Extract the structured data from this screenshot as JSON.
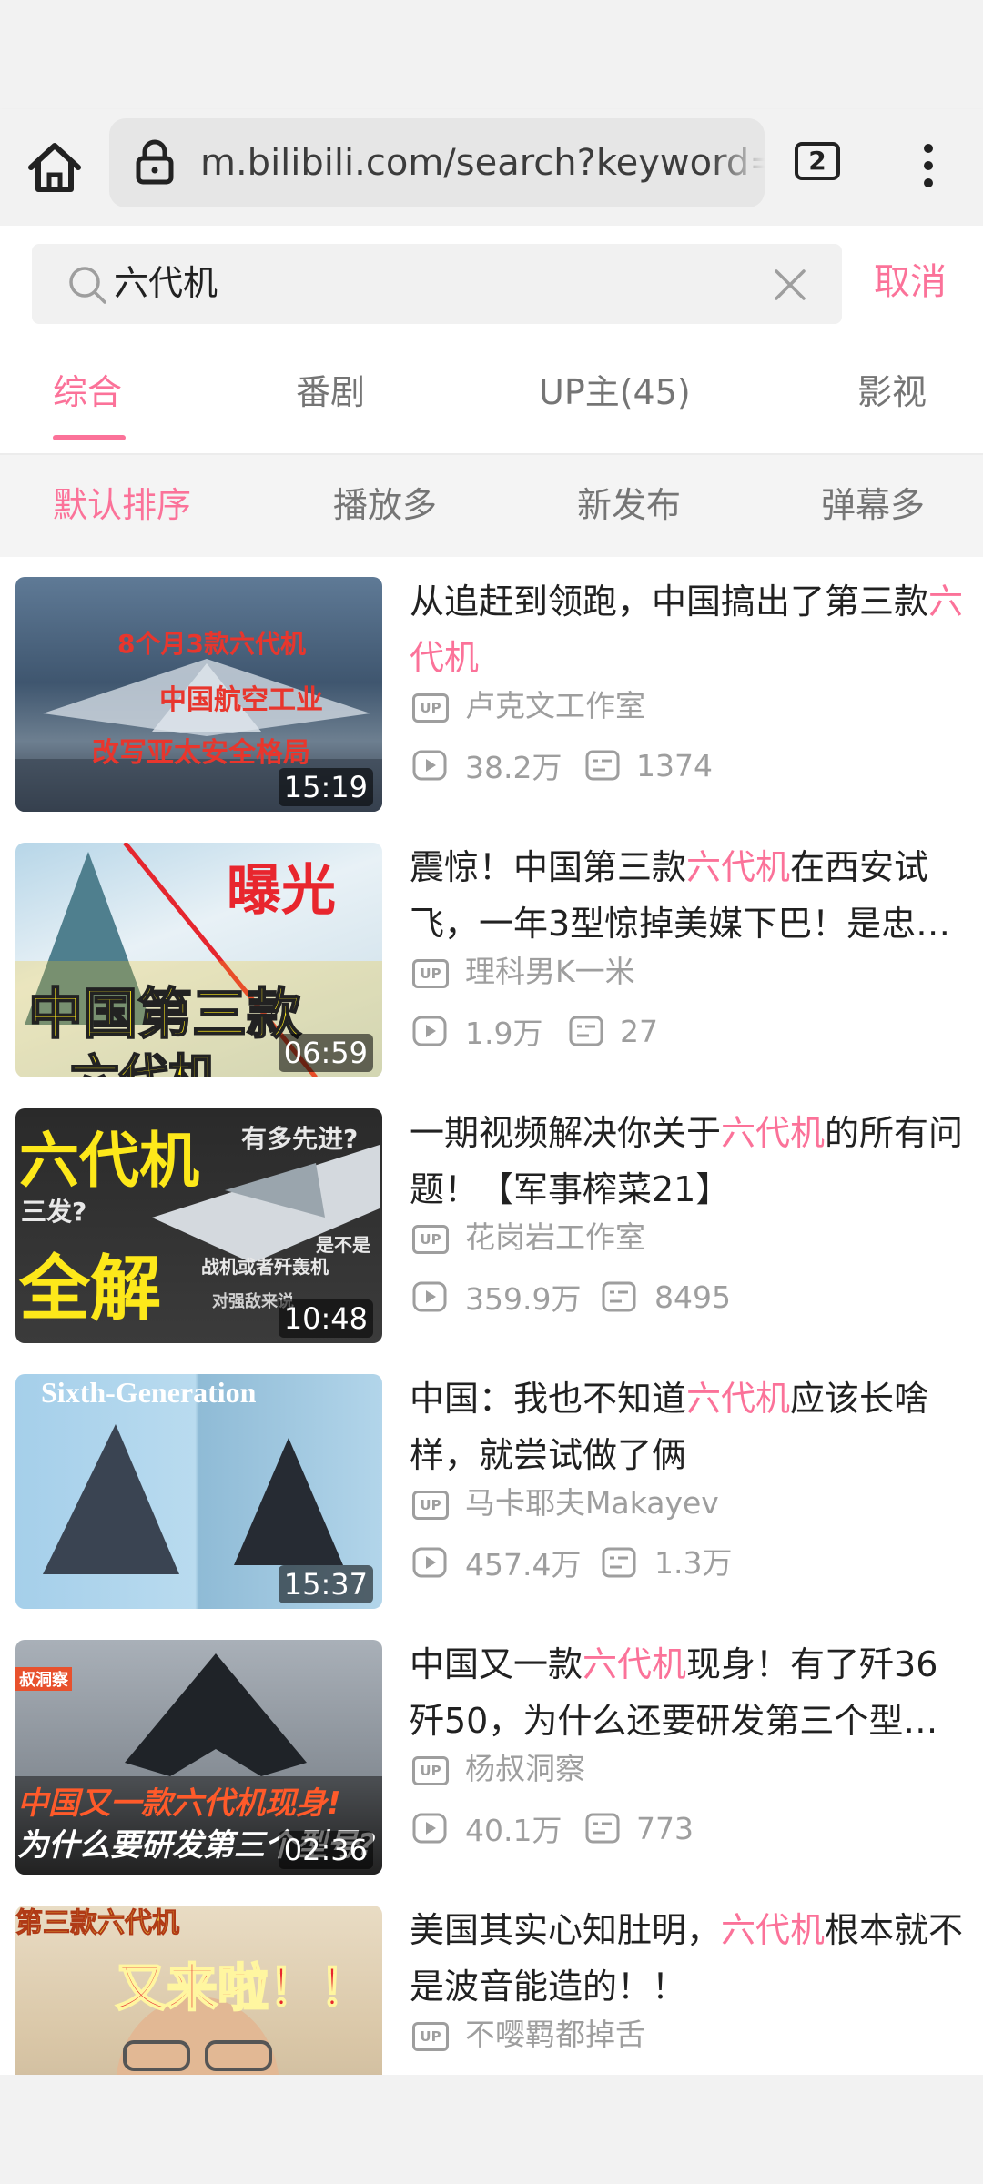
{
  "browser": {
    "url": "m.bilibili.com/search?keyword=",
    "tab_count": "2"
  },
  "search": {
    "value": "六代机",
    "cancel_label": "取消"
  },
  "tabs": [
    {
      "label": "综合",
      "active": true
    },
    {
      "label": "番剧"
    },
    {
      "label": "UP主(45)"
    },
    {
      "label": "影视"
    }
  ],
  "sort_options": [
    {
      "label": "默认排序",
      "active": true
    },
    {
      "label": "播放多"
    },
    {
      "label": "新发布"
    },
    {
      "label": "弹幕多"
    }
  ],
  "videos": [
    {
      "title_before": "从追赶到领跑，中国搞出了第三款",
      "title_highlight": "六代机",
      "title_after": "",
      "uploader": "卢克文工作室",
      "plays": "38.2万",
      "danmaku": "1374",
      "duration": "15:19",
      "thumb_text": [
        "8个月3款六代机",
        "中国航空工业",
        "改写亚太安全格局"
      ]
    },
    {
      "title_before": "震惊！中国第三款",
      "title_highlight": "六代机",
      "title_after": "在西安试飞，一年3型惊掉美媒下巴！是忠…",
      "uploader": "理科男K一米",
      "plays": "1.9万",
      "danmaku": "27",
      "duration": "06:59",
      "thumb_text": [
        "曝光",
        "中国第三款",
        "六代机"
      ]
    },
    {
      "title_before": "一期视频解决你关于",
      "title_highlight": "六代机",
      "title_after": "的所有问题！【军事榨菜21】",
      "uploader": "花岗岩工作室",
      "plays": "359.9万",
      "danmaku": "8495",
      "duration": "10:48",
      "thumb_text": [
        "六代机",
        "有多先进?",
        "三发?",
        "全解",
        "是不是",
        "战机或者歼轰机",
        "对强敌来说"
      ]
    },
    {
      "title_before": "中国：我也不知道",
      "title_highlight": "六代机",
      "title_after": "应该长啥样，就尝试做了俩",
      "uploader": "马卡耶夫Makayev",
      "plays": "457.4万",
      "danmaku": "1.3万",
      "duration": "15:37",
      "thumb_text": [
        "Sixth-Generation"
      ]
    },
    {
      "title_before": "中国又一款",
      "title_highlight": "六代机",
      "title_after": "现身！有了歼36歼50，为什么还要研发第三个型…",
      "uploader": "杨叔洞察",
      "plays": "40.1万",
      "danmaku": "773",
      "duration": "02:36",
      "thumb_text": [
        "叔洞察",
        "中国又一款六代机现身!",
        "为什么要研发第三个型号?"
      ]
    },
    {
      "title_before": "美国其实心知肚明，",
      "title_highlight": "六代机",
      "title_after": "根本就不是波音能造的！！",
      "uploader": "不嘤羁都掉舌",
      "plays": "",
      "danmaku": "",
      "duration": "",
      "thumb_text": [
        "第三款六代机",
        "又来啦！！"
      ]
    }
  ]
}
